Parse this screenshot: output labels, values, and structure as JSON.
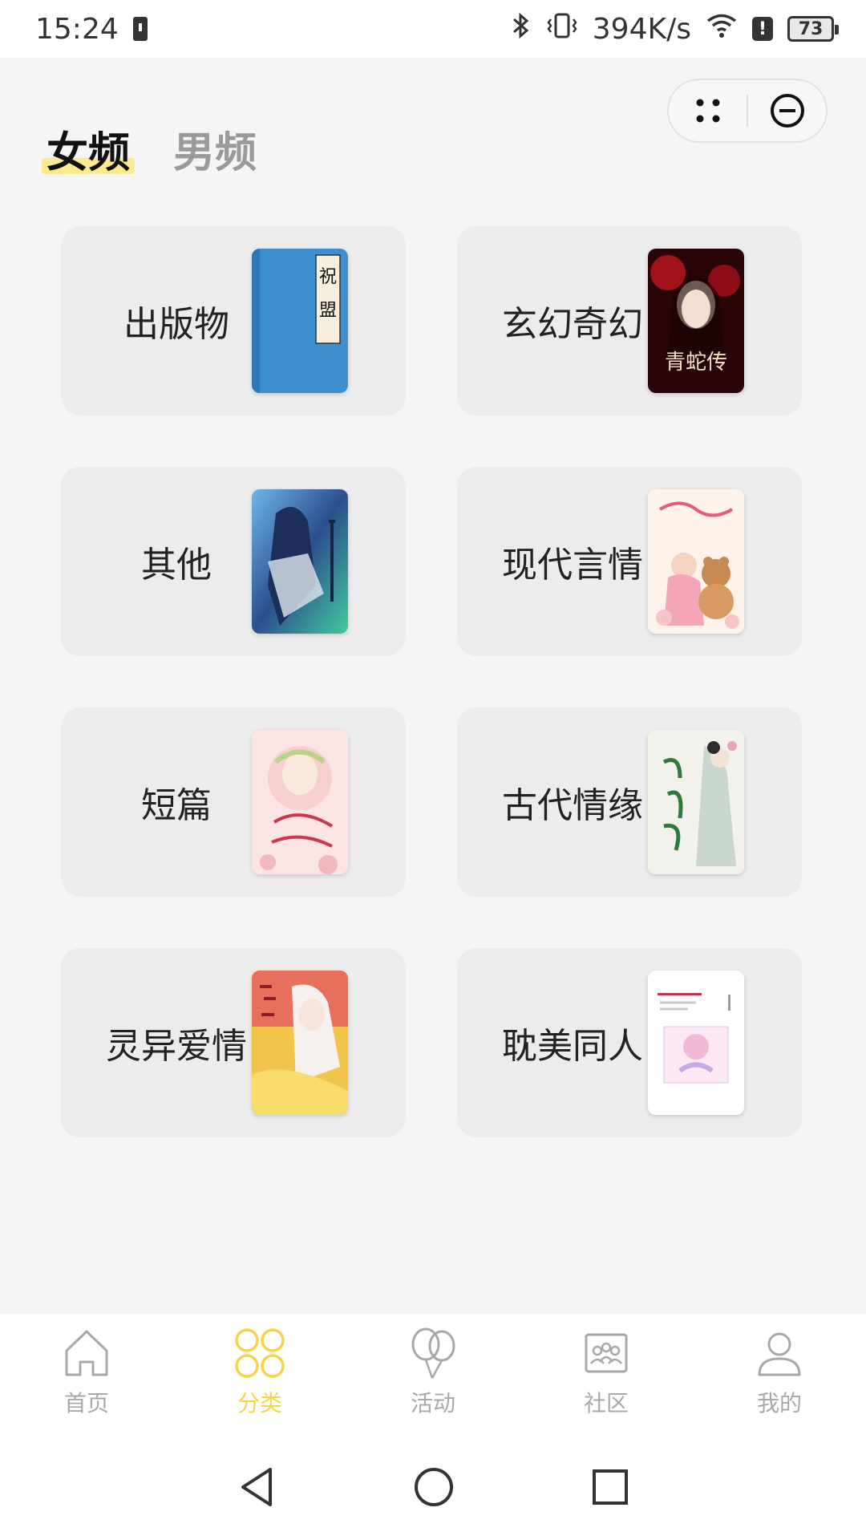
{
  "status_bar": {
    "time": "15:24",
    "network_speed": "394K/s",
    "battery_level": "73",
    "alert": "!"
  },
  "tabs": [
    {
      "label": "女频",
      "active": true
    },
    {
      "label": "男频",
      "active": false
    }
  ],
  "categories": [
    {
      "label": "出版物",
      "cover": "blue-classic-book-cover"
    },
    {
      "label": "玄幻奇幻",
      "cover": "dark-red-rose-lady-cover"
    },
    {
      "label": "其他",
      "cover": "blue-warrior-cover"
    },
    {
      "label": "现代言情",
      "cover": "pink-teddy-bear-cover"
    },
    {
      "label": "短篇",
      "cover": "pink-floral-girl-cover"
    },
    {
      "label": "古代情缘",
      "cover": "green-ancient-lady-cover"
    },
    {
      "label": "灵异爱情",
      "cover": "yellow-fox-spirit-cover"
    },
    {
      "label": "耽美同人",
      "cover": "white-pastel-cover"
    }
  ],
  "cover_text": {
    "c0_title_1": "祝",
    "c0_title_2": "盟",
    "c1_title": "青蛇传"
  },
  "bottom_nav": [
    {
      "label": "首页",
      "icon": "home-icon",
      "active": false
    },
    {
      "label": "分类",
      "icon": "category-icon",
      "active": true
    },
    {
      "label": "活动",
      "icon": "balloon-icon",
      "active": false
    },
    {
      "label": "社区",
      "icon": "community-icon",
      "active": false
    },
    {
      "label": "我的",
      "icon": "profile-icon",
      "active": false
    }
  ],
  "colors": {
    "accent": "#f5d44a",
    "tab_highlight": "#fde98f",
    "card_bg": "#ececec",
    "page_bg": "#f5f5f5"
  }
}
